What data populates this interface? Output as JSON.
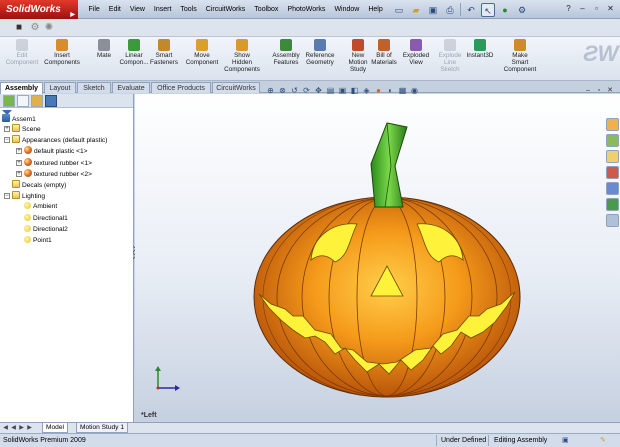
{
  "app": {
    "logo_text": "SolidWorks",
    "menu": [
      "File",
      "Edit",
      "View",
      "Insert",
      "Tools",
      "CircuitWorks",
      "Toolbox",
      "PhotoWorks",
      "Window",
      "Help"
    ]
  },
  "ribbon": {
    "buttons": [
      {
        "label": "Edit\nComponent",
        "enabled": false,
        "icon": "edit-component-icon",
        "color": "#9aa3b0"
      },
      {
        "label": "Insert\nComponents",
        "enabled": true,
        "icon": "insert-components-icon",
        "color": "#d98c2a"
      },
      {
        "label": "Mate",
        "enabled": true,
        "icon": "mate-icon",
        "color": "#8a8f99"
      },
      {
        "label": "Linear\nCompon...",
        "enabled": true,
        "icon": "linear-pattern-icon",
        "color": "#3a9a3a"
      },
      {
        "label": "Smart\nFasteners",
        "enabled": true,
        "icon": "smart-fasteners-icon",
        "color": "#c08a2a"
      },
      {
        "label": "Move\nComponent",
        "enabled": true,
        "icon": "move-component-icon",
        "color": "#d9a02a"
      },
      {
        "label": "Show\nHidden\nComponents",
        "enabled": true,
        "icon": "show-hidden-icon",
        "color": "#d99a2a"
      },
      {
        "label": "Assembly\nFeatures",
        "enabled": true,
        "icon": "assembly-features-icon",
        "color": "#3a8a3a"
      },
      {
        "label": "Reference\nGeometry",
        "enabled": true,
        "icon": "reference-geometry-icon",
        "color": "#5a7ab0"
      },
      {
        "label": "New\nMotion\nStudy",
        "enabled": true,
        "icon": "motion-study-icon",
        "color": "#c04a2a"
      },
      {
        "label": "Bill of\nMaterials",
        "enabled": true,
        "icon": "bill-of-materials-icon",
        "color": "#c0602a"
      },
      {
        "label": "Exploded\nView",
        "enabled": true,
        "icon": "exploded-view-icon",
        "color": "#8a5ab0"
      },
      {
        "label": "Explode\nLine\nSketch",
        "enabled": false,
        "icon": "explode-line-icon",
        "color": "#9aa3b0"
      },
      {
        "label": "Instant3D",
        "enabled": true,
        "icon": "instant3d-icon",
        "color": "#2a9a5a"
      },
      {
        "label": "Make\nSmart\nComponent",
        "enabled": true,
        "icon": "smart-component-icon",
        "color": "#d08a2a"
      }
    ]
  },
  "command_tabs": [
    "Assembly",
    "Layout",
    "Sketch",
    "Evaluate",
    "Office Products",
    "CircuitWorks"
  ],
  "active_command_tab": "Assembly",
  "tree": {
    "root": "Assem1",
    "items": [
      {
        "label": "Scene",
        "icon": "folder",
        "expandable": true
      },
      {
        "label": "Appearances (default plastic)",
        "icon": "folder",
        "expandable": true
      },
      {
        "label": "default plastic <1>",
        "icon": "appearance",
        "expandable": true
      },
      {
        "label": "textured rubber <1>",
        "icon": "appearance",
        "expandable": true
      },
      {
        "label": "textured rubber <2>",
        "icon": "appearance",
        "expandable": true
      },
      {
        "label": "Decals (empty)",
        "icon": "folder",
        "expandable": false
      },
      {
        "label": "Lighting",
        "icon": "folder",
        "expandable": true
      },
      {
        "label": "Ambient",
        "icon": "light",
        "expandable": false
      },
      {
        "label": "Directional1",
        "icon": "light",
        "expandable": false
      },
      {
        "label": "Directional2",
        "icon": "light",
        "expandable": false
      },
      {
        "label": "Point1",
        "icon": "light",
        "expandable": false
      }
    ]
  },
  "viewport": {
    "view_label": "*Left",
    "colors": {
      "pumpkin": "#f08a14",
      "stem": "#3aa82a",
      "face": "#fff23a"
    }
  },
  "bottom_tabs": [
    "Model",
    "Motion Study 1"
  ],
  "active_bottom_tab": "Model",
  "status": {
    "product": "SolidWorks Premium 2009",
    "state": "Under Defined",
    "mode": "Editing Assembly"
  }
}
